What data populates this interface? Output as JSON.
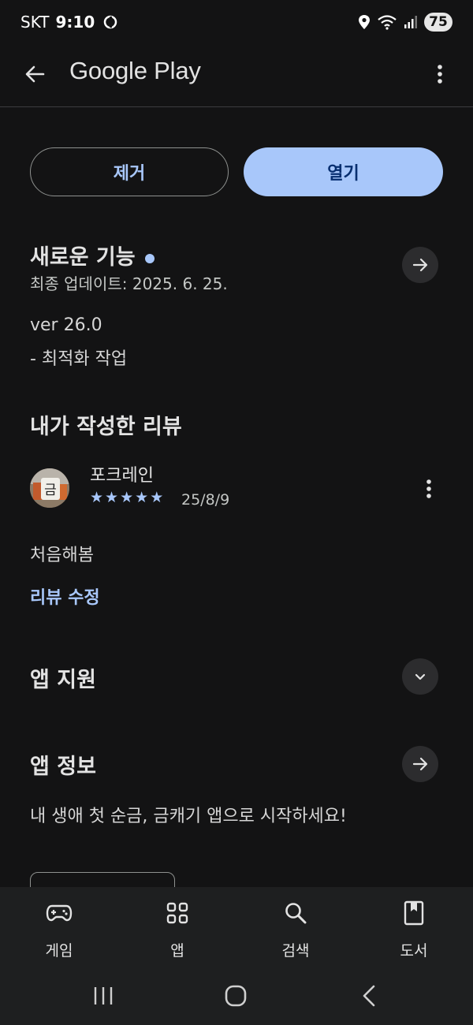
{
  "status_bar": {
    "carrier": "SKT",
    "time": "9:10",
    "battery": "75"
  },
  "app_bar": {
    "title": "Google Play"
  },
  "actions": {
    "uninstall_label": "제거",
    "open_label": "열기"
  },
  "whats_new": {
    "title": "새로운 기능",
    "last_updated": "최종 업데이트: 2025. 6. 25.",
    "version": "ver 26.0",
    "note": "- 최적화 작업"
  },
  "my_review": {
    "title": "내가 작성한 리뷰",
    "reviewer_name": "포크레인",
    "rating": 5,
    "date": "25/8/9",
    "text": "처음해봄",
    "edit_label": "리뷰 수정"
  },
  "app_support": {
    "title": "앱 지원"
  },
  "about_app": {
    "title": "앱 정보",
    "description": "내 생애 첫 순금, 금캐기 앱으로 시작하세요!"
  },
  "bottom_nav": {
    "items": [
      {
        "label": "게임",
        "icon": "gamepad-icon"
      },
      {
        "label": "앱",
        "icon": "apps-grid-icon"
      },
      {
        "label": "검색",
        "icon": "search-icon"
      },
      {
        "label": "도서",
        "icon": "book-icon"
      }
    ]
  },
  "colors": {
    "background": "#131314",
    "accent": "#a8c7fa",
    "accent_on": "#062e6f",
    "surface": "#1e1f20"
  }
}
